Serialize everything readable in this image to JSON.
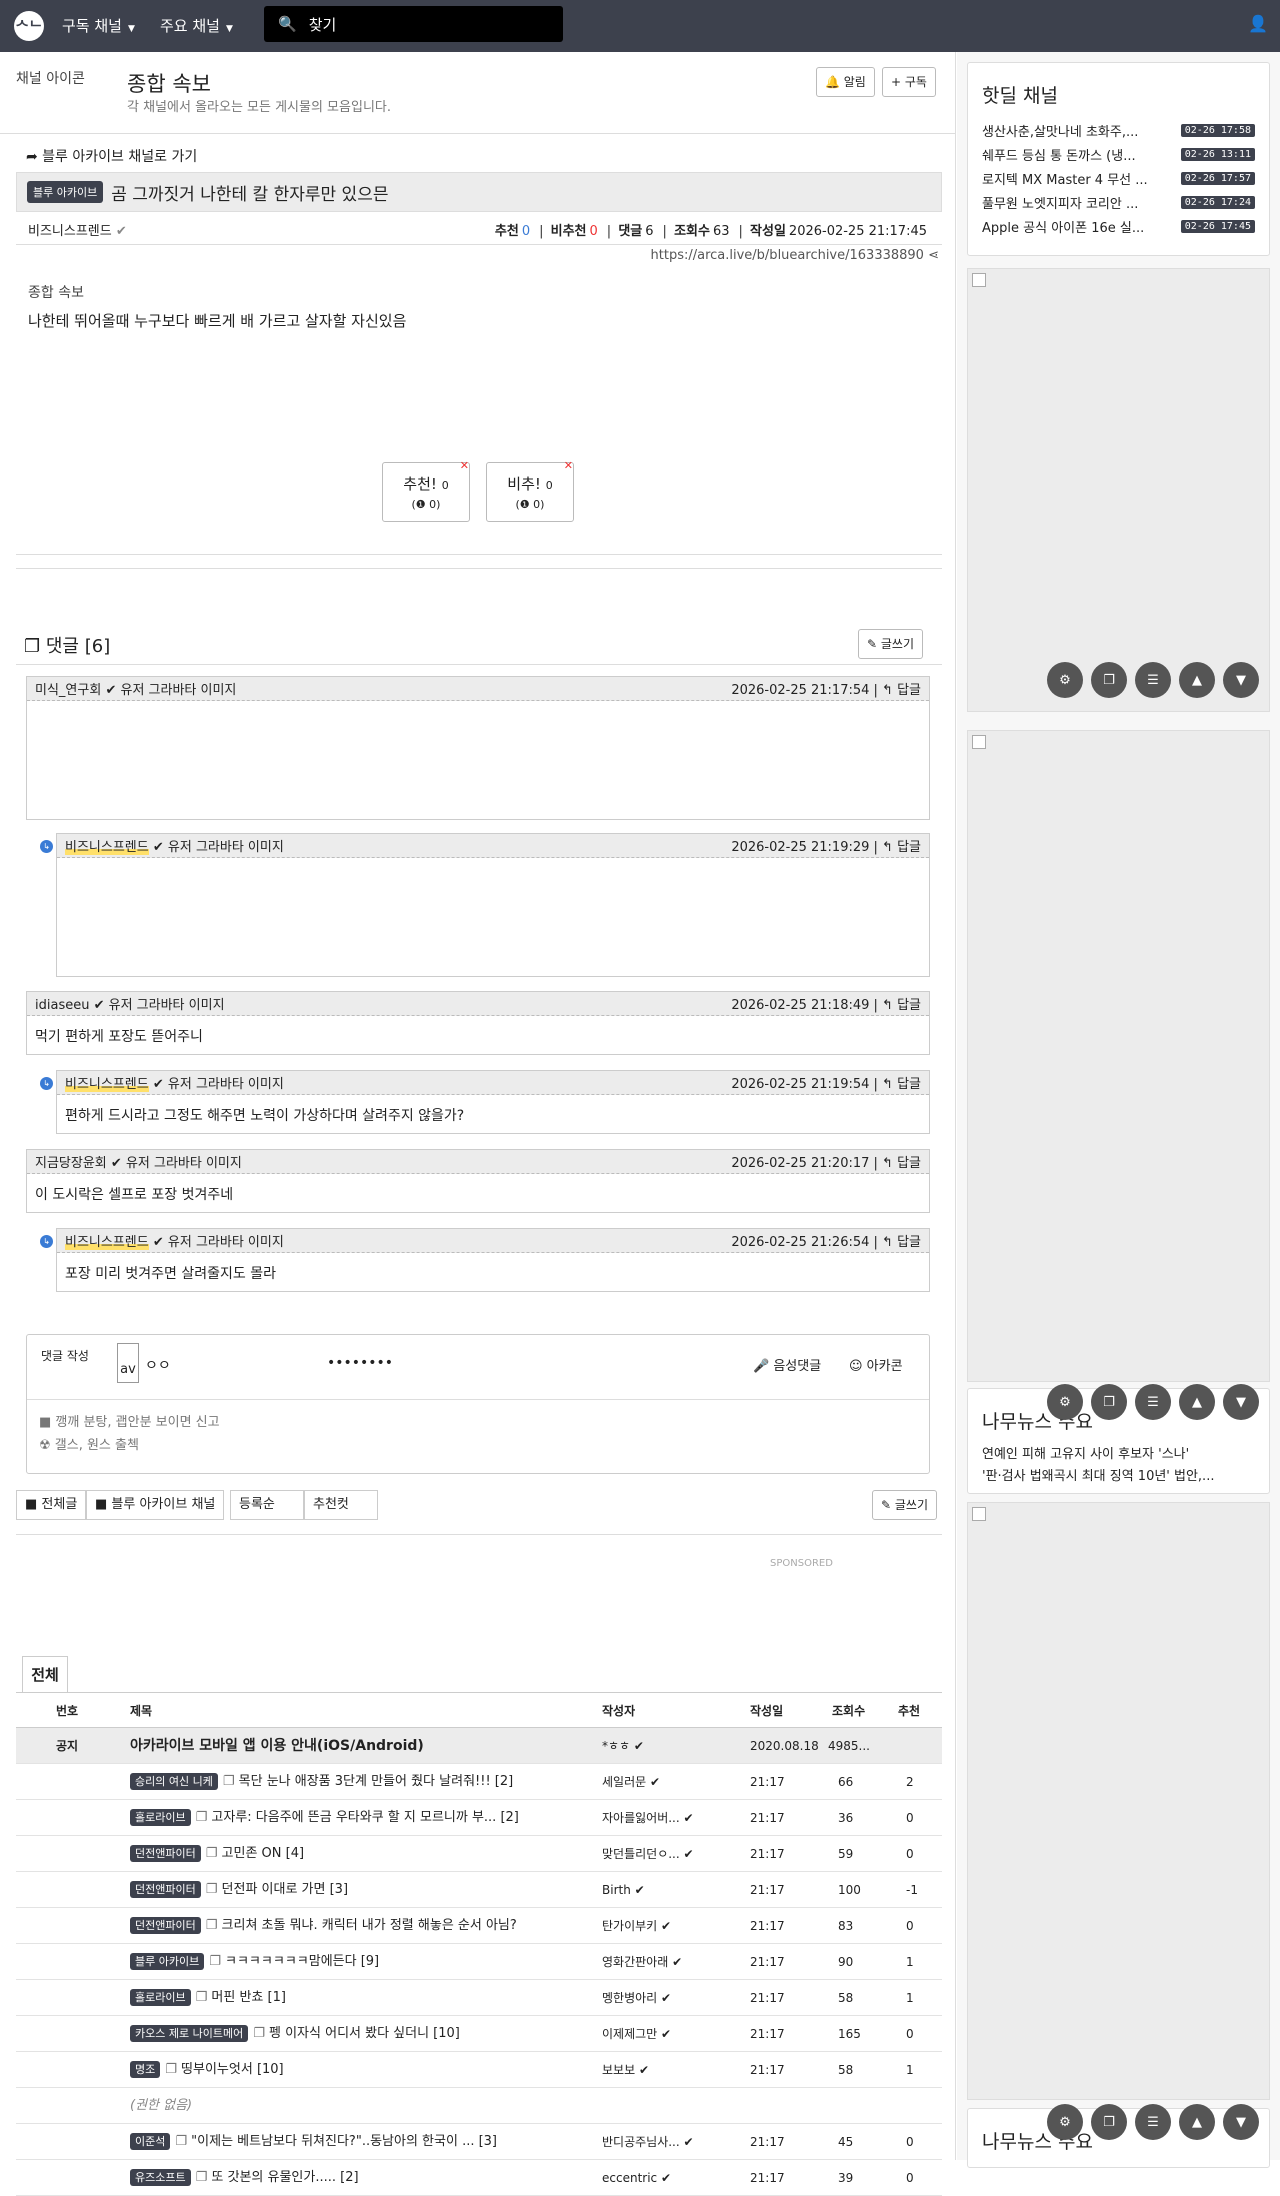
{
  "nav": {
    "logo": "ᄉᄂ",
    "item1": "구독 채널",
    "item2": "주요 채널",
    "search": "찾기"
  },
  "channel": {
    "img_alt": "채널 아이콘",
    "title": "종합 속보",
    "desc": "각 채널에서 올라오는 모든 게시물의 모음입니다.",
    "alarm": "🔔 알림",
    "subscribe": "+ 구독"
  },
  "article": {
    "back": "➦ 블루 아카이브 채널로 가기",
    "badge": "블루 아카이브",
    "title": "곰 그까짓거 나한테 칼 한자루만 있으믄",
    "author": "비즈니스프렌드",
    "rec_label": "추천",
    "rec": "0",
    "unrec_label": "비추천",
    "unrec": "0",
    "cmt_label": "댓글",
    "cmt": "6",
    "view_label": "조회수",
    "view": "63",
    "date_label": "작성일",
    "date": "2026-02-25 21:17:45",
    "url": "https://arca.live/b/bluearchive/163338890",
    "img_alt": "종합 속보",
    "body": "나한테 뛰어올때 누구보다 빠르게 배 가르고 살자할 자신있음",
    "vote_up": "추천!",
    "vote_up_n": "0",
    "vote_up_sub": "(❶ 0)",
    "vote_down": "비추!",
    "vote_down_n": "0",
    "vote_down_sub": "(❶ 0)"
  },
  "comments": {
    "title": "댓글 [6]",
    "write": "글쓰기",
    "avatar_alt": "유저 그라바타 이미지",
    "reply": "↰ 답글",
    "items": [
      {
        "name": "미식_연구회",
        "date": "2026-02-25 21:17:54",
        "text": ""
      },
      {
        "name": "비즈니스프렌드",
        "date": "2026-02-25 21:19:29",
        "text": ""
      },
      {
        "name": "idiaseeu",
        "date": "2026-02-25 21:18:49",
        "text": "먹기 편하게 포장도 뜯어주니"
      },
      {
        "name": "비즈니스프렌드",
        "date": "2026-02-25 21:19:54",
        "text": "편하게 드시라고 그정도 해주면 노력이 가상하다며 살려주지 않을가?"
      },
      {
        "name": "지금당장윤회",
        "date": "2026-02-25 21:20:17",
        "text": "이 도시락은 셀프로 포장 벗겨주네"
      },
      {
        "name": "비즈니스프렌드",
        "date": "2026-02-25 21:26:54",
        "text": "포장 미리 벗겨주면 살려줄지도 몰라"
      }
    ]
  },
  "cform": {
    "label": "댓글 작성",
    "av": "av",
    "name": "ㅇㅇ",
    "pw": "••••••••",
    "voice": "🎤 음성댓글",
    "arca": "☺ 아카콘",
    "rule1": "■ 깽깨 분탕, 괩안분 보이면 신고",
    "rule2": "☢ 갤스, 원스 출첵"
  },
  "tabs": {
    "all": "■ 전체글",
    "ch": "■ 블루 아카이브 채널",
    "reg": "등록순",
    "rec": "추천컷",
    "write": "글쓰기"
  },
  "sponsored": "SPONSORED",
  "list": {
    "tab": "전체",
    "h_no": "번호",
    "h_title": "제목",
    "h_author": "작성자",
    "h_date": "작성일",
    "h_view": "조회수",
    "h_rec": "추천",
    "notice": {
      "no": "공지",
      "title": "아카라이브 모바일 앱 이용 안내(iOS/Android)",
      "author": "*ㅎㅎ",
      "date": "2020.08.18",
      "view": "4985...",
      "rec": ""
    },
    "rows": [
      {
        "badge": "승리의 여신 니케",
        "title": "목단 눈나 애장품 3단계 만들어 줬다 날려줘!!! [2]",
        "author": "세일러문",
        "date": "21:17",
        "view": "66",
        "rec": "2"
      },
      {
        "badge": "홀로라이브",
        "title": "고자루: 다음주에 뜬금 우타와쿠 할 지 모르니까 부... [2]",
        "author": "자아를잃어버...",
        "date": "21:17",
        "view": "36",
        "rec": "0"
      },
      {
        "badge": "던전앤파이터",
        "title": "고민존 ON [4]",
        "author": "맞던틀리던ㅇ...",
        "date": "21:17",
        "view": "59",
        "rec": "0"
      },
      {
        "badge": "던전앤파이터",
        "title": "던전파 이대로 가면 [3]",
        "author": "Birth",
        "date": "21:17",
        "view": "100",
        "rec": "-1"
      },
      {
        "badge": "던전앤파이터",
        "title": "크리쳐 초돌 뭐냐. 캐릭터 내가 정렬 해놓은 순서 아님?",
        "author": "탄가이부키",
        "date": "21:17",
        "view": "83",
        "rec": "0"
      },
      {
        "badge": "블루 아카이브",
        "title": "ㅋㅋㅋㅋㅋㅋㅋ맘에든다 [9]",
        "author": "영화간판아래",
        "date": "21:17",
        "view": "90",
        "rec": "1"
      },
      {
        "badge": "홀로라이브",
        "title": "머핀 반쵸 [1]",
        "author": "멩한병아리",
        "date": "21:17",
        "view": "58",
        "rec": "1"
      },
      {
        "badge": "카오스 제로 나이트메어",
        "title": "펭 이자식 어디서 봤다 싶더니 [10]",
        "author": "이제제그만",
        "date": "21:17",
        "view": "165",
        "rec": "0"
      },
      {
        "badge": "명조",
        "title": "띵부이누엇서 [10]",
        "author": "보보보",
        "date": "21:17",
        "view": "58",
        "rec": "1"
      }
    ],
    "noperm": "(권한 없음)",
    "rows2": [
      {
        "badge": "이준석",
        "title": "\"이제는 베트남보다 뒤쳐진다?\"..동남아의 한국이 ... [3]",
        "author": "반디공주님사...",
        "date": "21:17",
        "view": "45",
        "rec": "0"
      },
      {
        "badge": "유즈소프트",
        "title": "또 갓본의 유물인가..... [2]",
        "author": "eccentric",
        "date": "21:17",
        "view": "39",
        "rec": "0"
      }
    ]
  },
  "side": {
    "hot_title": "핫딜 채널",
    "hot": [
      {
        "t": "생산사춘,살맛나네 초화주,...",
        "tm": "02-26 17:58"
      },
      {
        "t": "쉐푸드 등심 통 돈까스 (냉...",
        "tm": "02-26 13:11"
      },
      {
        "t": "로지텍 MX Master 4 무선 ...",
        "tm": "02-26 17:57"
      },
      {
        "t": "풀무원 노엣지피자 코리안 ...",
        "tm": "02-26 17:24"
      },
      {
        "t": "Apple 공식 아이폰 16e 실...",
        "tm": "02-26 17:45"
      }
    ],
    "news_title": "나무뉴스 주요",
    "news1": "연예인 피해 고유지 사이 후보자 '스나'",
    "news2": "'판·검사 법왜곡시 최대 징역 10년' 법안,..."
  }
}
